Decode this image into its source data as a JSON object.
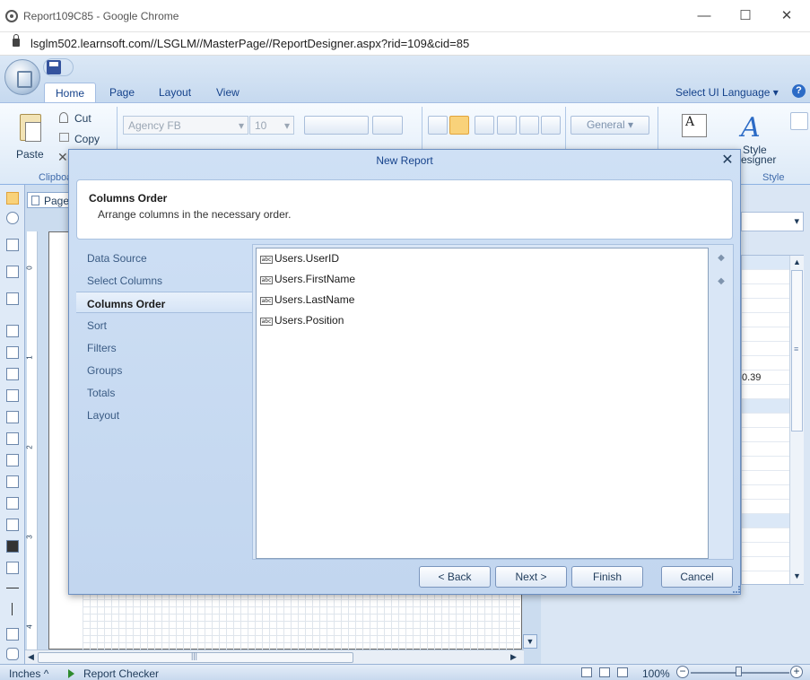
{
  "browser": {
    "window_title": "Report109C85 - Google Chrome",
    "url": "lsglm502.learnsoft.com//LSGLM//MasterPage//ReportDesigner.aspx?rid=109&cid=85",
    "minimize_glyph": "—",
    "maximize_glyph": "☐",
    "close_glyph": "✕"
  },
  "ribbon": {
    "tabs": [
      "Home",
      "Page",
      "Layout",
      "View"
    ],
    "active_tab": "Home",
    "language_label": "Select UI Language",
    "language_arrow": "▾",
    "help_glyph": "?",
    "clipboard": {
      "paste": "Paste",
      "cut": "Cut",
      "copy": "Copy",
      "delete_glyph": "✕",
      "group_label": "Clipboa"
    },
    "font_family": "Agency FB",
    "font_size": "10",
    "format_value": "General",
    "combo_arrow": "▾",
    "style_designer_line1": "Style",
    "style_designer_line2": "esigner",
    "style_group_label": "Style",
    "fmt_icon_text": "A"
  },
  "designer": {
    "page_tab": "Page",
    "ruler_numbers": [
      "0",
      "1",
      "2",
      "3",
      "4"
    ],
    "scroll_down_glyph": "▼",
    "scroll_left_glyph": "◀",
    "scroll_right_glyph": "▶",
    "scroll_thumb_grip": "|||"
  },
  "right_panel": {
    "visible_value": "0.39",
    "combo_arrow": "▾",
    "scroll_up_glyph": "▲",
    "scroll_down_glyph": "▼",
    "scroll_thumb_grip": "≡"
  },
  "statusbar": {
    "units": "Inches",
    "units_arrow": "^",
    "report_checker": "Report Checker",
    "zoom": "100%",
    "zoom_minus": "−",
    "zoom_plus": "+"
  },
  "dialog": {
    "title": "New Report",
    "close_glyph": "✕",
    "header_title": "Columns Order",
    "header_desc": "Arrange columns in the necessary order.",
    "steps": [
      "Data Source",
      "Select Columns",
      "Columns Order",
      "Sort",
      "Filters",
      "Groups",
      "Totals",
      "Layout"
    ],
    "active_step": "Columns Order",
    "columns": [
      "Users.UserID",
      "Users.FirstName",
      "Users.LastName",
      "Users.Position"
    ],
    "column_type_badge": "abc",
    "move_up_glyph": "◆",
    "move_down_glyph": "◆",
    "buttons": {
      "back": "< Back",
      "next": "Next >",
      "finish": "Finish",
      "cancel": "Cancel"
    }
  }
}
